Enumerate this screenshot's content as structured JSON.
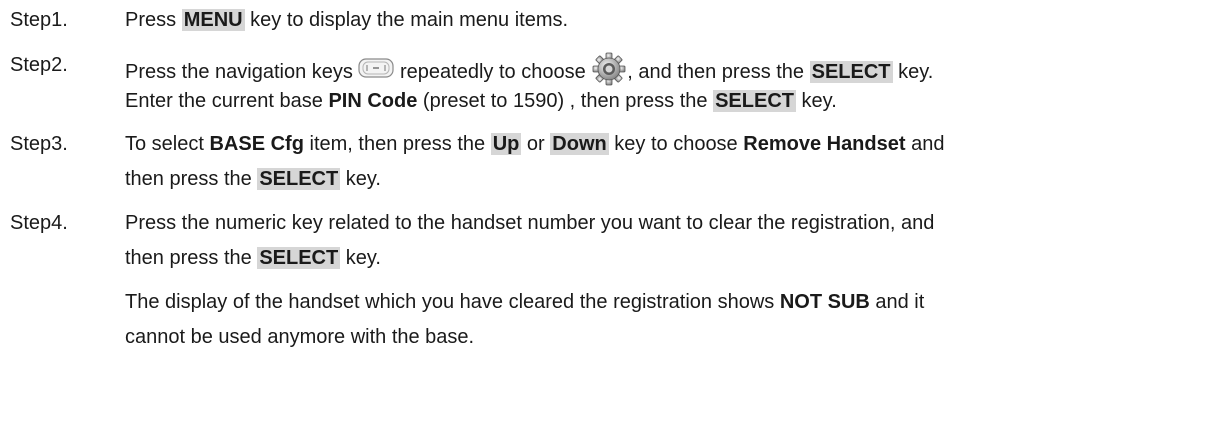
{
  "steps": [
    {
      "label": "Step1.",
      "lines": [
        [
          {
            "t": "Press "
          },
          {
            "t": "MENU",
            "s": "key"
          },
          {
            "t": " key to display the main menu items."
          }
        ]
      ]
    },
    {
      "label": "Step2.",
      "lines": [
        [
          {
            "t": "Press the navigation keys "
          },
          {
            "icon": "navigation-keys-icon"
          },
          {
            "t": " repeatedly to choose "
          },
          {
            "icon": "settings-gear-icon"
          },
          {
            "t": ", and then press the "
          },
          {
            "t": "SELECT",
            "s": "key"
          },
          {
            "t": " key."
          }
        ],
        [
          {
            "t": "Enter the current base "
          },
          {
            "t": "PIN Code",
            "s": "bold"
          },
          {
            "t": " (preset to 1590) , then press the "
          },
          {
            "t": "SELECT",
            "s": "key"
          },
          {
            "t": " key."
          }
        ]
      ]
    },
    {
      "label": "Step3.",
      "lines": [
        [
          {
            "t": "To select "
          },
          {
            "t": "BASE Cfg",
            "s": "bold"
          },
          {
            "t": " item, then press the "
          },
          {
            "t": "Up",
            "s": "key"
          },
          {
            "t": " or "
          },
          {
            "t": "Down",
            "s": "key"
          },
          {
            "t": " key to choose "
          },
          {
            "t": "Remove Handset",
            "s": "bold"
          },
          {
            "t": " and"
          }
        ],
        [
          {
            "t": "then press the "
          },
          {
            "t": "SELECT",
            "s": "key"
          },
          {
            "t": " key."
          }
        ]
      ]
    },
    {
      "label": "Step4.",
      "lines": [
        [
          {
            "t": "Press the numeric key related to the handset number you want to clear the registration, and"
          }
        ],
        [
          {
            "t": "then press the "
          },
          {
            "t": "SELECT",
            "s": "key"
          },
          {
            "t": " key."
          }
        ],
        [
          {
            "t": "The display of the handset which you have cleared the registration shows "
          },
          {
            "t": "NOT SUB",
            "s": "bold"
          },
          {
            "t": " and it"
          }
        ],
        [
          {
            "t": "cannot be used anymore with the base."
          }
        ]
      ]
    }
  ]
}
